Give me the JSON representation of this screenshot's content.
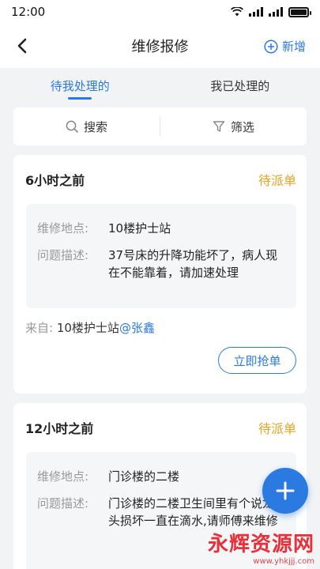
{
  "status_bar": {
    "time": "12:00"
  },
  "nav": {
    "title": "维修报修",
    "add_label": "新增"
  },
  "tabs": [
    {
      "label": "待我处理的",
      "active": true
    },
    {
      "label": "我已处理的",
      "active": false
    }
  ],
  "toolbar": {
    "search_label": "搜索",
    "filter_label": "筛选"
  },
  "cards": [
    {
      "time": "6小时之前",
      "status": "待派单",
      "location_label": "维修地点:",
      "location": "10楼护士站",
      "desc_label": "问题描述:",
      "desc": "37号床的升降功能坏了，病人现在不能靠着，请加速处理",
      "from_label": "来自:",
      "from_place": "10楼护士站",
      "from_user": "@张鑫",
      "button": "立即抢单"
    },
    {
      "time": "12小时之前",
      "status": "待派单",
      "location_label": "维修地点:",
      "location": "门诊楼的二楼",
      "desc_label": "问题描述:",
      "desc": "门诊楼的二楼卫生间里有个说龙头损坏一直在滴水,请师傅来维修"
    }
  ],
  "watermark": {
    "main": "永辉资源网",
    "sub": "www.yhkjjj.com"
  },
  "colors": {
    "accent": "#2a7ae2",
    "pending": "#f0a020",
    "background": "#f2f3f5"
  }
}
